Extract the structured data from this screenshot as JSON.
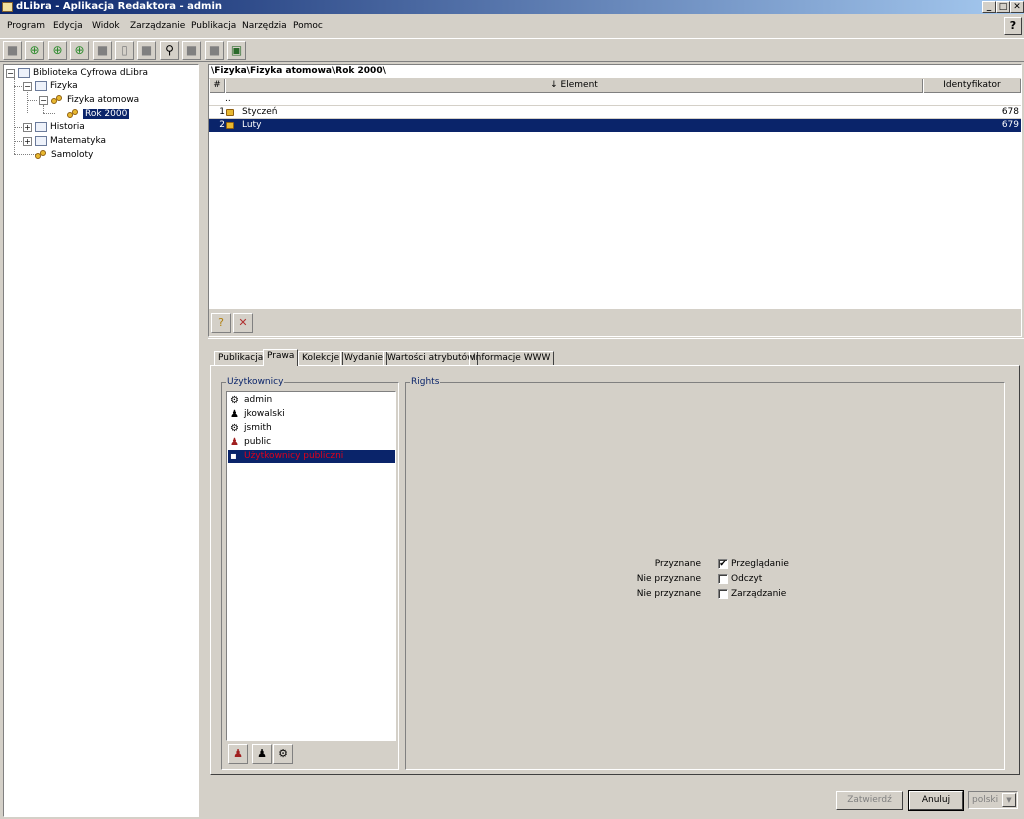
{
  "window": {
    "title": "dLibra - Aplikacja Redaktora - admin"
  },
  "menubar": {
    "items": [
      "Program",
      "Edycja",
      "Widok",
      "Zarządzanie",
      "Publikacja",
      "Narzędzia",
      "Pomoc"
    ]
  },
  "toolbar": {
    "buttons": [
      "folder-icon",
      "add-collection-icon",
      "add-element-icon",
      "add-publication-icon",
      "publish-icon",
      "delete-icon",
      "properties-icon",
      "search-icon",
      "copy-icon",
      "move-icon",
      "refresh-icon"
    ]
  },
  "tree": {
    "root": "Biblioteka Cyfrowa dLibra",
    "fizyka": "Fizyka",
    "fizyka_atomowa": "Fizyka atomowa",
    "rok2000": "Rok 2000",
    "historia": "Historia",
    "matematyka": "Matematyka",
    "samoloty": "Samoloty"
  },
  "table": {
    "breadcrumb": "\\Fizyka\\Fizyka atomowa\\Rok 2000\\",
    "columns": [
      "#",
      "↓ Element",
      "Identyfikator"
    ],
    "parent_row": "..",
    "rows": [
      {
        "num": "1",
        "element": "Styczeń",
        "id": "678"
      },
      {
        "num": "2",
        "element": "Luty",
        "id": "679"
      }
    ]
  },
  "tabs": [
    "Publikacja",
    "Prawa",
    "Kolekcje",
    "Wydanie",
    "Wartości atrybutów",
    "Informacje WWW"
  ],
  "active_tab": "Prawa",
  "users": {
    "legend": "Użytkownicy",
    "items": [
      {
        "name": "admin",
        "icon": "admin-user-icon"
      },
      {
        "name": "jkowalski",
        "icon": "user-icon"
      },
      {
        "name": "jsmith",
        "icon": "admin-user-icon"
      },
      {
        "name": "public",
        "icon": "public-group-icon"
      },
      {
        "name": "Użytkownicy publiczni",
        "icon": "public-users-icon"
      }
    ]
  },
  "rights": {
    "legend": "Rights",
    "items": [
      {
        "status": "Przyznane",
        "label": "Przeglądanie",
        "checked": true
      },
      {
        "status": "Nie przyznane",
        "label": "Odczyt",
        "checked": false
      },
      {
        "status": "Nie przyznane",
        "label": "Zarządzanie",
        "checked": false
      }
    ]
  },
  "buttons": {
    "confirm": "Zatwierdź",
    "cancel": "Anuluj"
  },
  "language": {
    "selected": "polski"
  }
}
